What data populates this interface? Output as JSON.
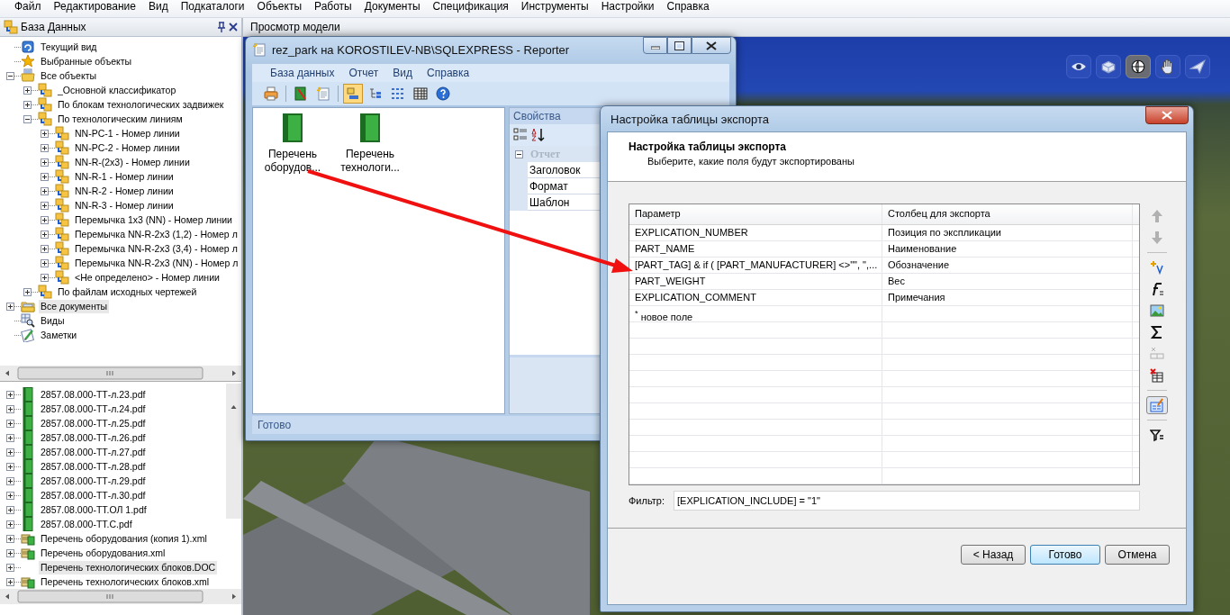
{
  "menu_bar": [
    "Файл",
    "Редактирование",
    "Вид",
    "Подкаталоги",
    "Объекты",
    "Работы",
    "Документы",
    "Спецификация",
    "Инструменты",
    "Настройки",
    "Справка"
  ],
  "database_panel": {
    "title": "База Данных",
    "tree": [
      {
        "label": "Текущий вид",
        "kind": "view",
        "selected": false
      },
      {
        "label": "Выбранные объекты",
        "kind": "star",
        "selected": false
      },
      {
        "label": "Все объекты",
        "kind": "objects",
        "selected": false,
        "expanded": true,
        "children": [
          {
            "label": "_Основной классификатор",
            "kind": "group",
            "selected": false,
            "expanded": false
          },
          {
            "label": "По блокам технологических задвижек",
            "kind": "group",
            "selected": false,
            "expanded": false
          },
          {
            "label": "По технологическим линиям",
            "kind": "group",
            "selected": false,
            "expanded": true,
            "children": [
              {
                "label": "NN-PC-1 - Номер линии",
                "kind": "group",
                "selected": false,
                "expanded": false
              },
              {
                "label": "NN-PC-2 - Номер линии",
                "kind": "group",
                "selected": false,
                "expanded": false
              },
              {
                "label": "NN-R-(2x3) - Номер линии",
                "kind": "group",
                "selected": false,
                "expanded": false
              },
              {
                "label": "NN-R-1 - Номер линии",
                "kind": "group",
                "selected": false,
                "expanded": false
              },
              {
                "label": "NN-R-2 - Номер линии",
                "kind": "group",
                "selected": false,
                "expanded": false
              },
              {
                "label": "NN-R-3 - Номер линии",
                "kind": "group",
                "selected": false,
                "expanded": false
              },
              {
                "label": "Перемычка 1x3 (NN) - Номер линии",
                "kind": "group",
                "selected": false,
                "expanded": false
              },
              {
                "label": "Перемычка NN-R-2x3 (1,2) - Номер л",
                "kind": "group",
                "selected": false,
                "expanded": false
              },
              {
                "label": "Перемычка NN-R-2x3 (3,4) - Номер л",
                "kind": "group",
                "selected": false,
                "expanded": false
              },
              {
                "label": "Перемычка NN-R-2x3 (NN) - Номер л",
                "kind": "group",
                "selected": false,
                "expanded": false
              },
              {
                "label": "<Не определено> - Номер линии",
                "kind": "group",
                "selected": false,
                "expanded": false
              }
            ]
          },
          {
            "label": "По файлам исходных чертежей",
            "kind": "group",
            "selected": false,
            "expanded": false
          }
        ]
      },
      {
        "label": "Все документы",
        "kind": "documents",
        "selected": true,
        "expanded": false
      },
      {
        "label": "Виды",
        "kind": "views",
        "selected": false
      },
      {
        "label": "Заметки",
        "kind": "notes",
        "selected": false
      }
    ],
    "files": [
      {
        "label": "2857.08.000-ТТ-л.23.pdf",
        "kind": "pdf",
        "selected": false,
        "expanded": false
      },
      {
        "label": "2857.08.000-ТТ-л.24.pdf",
        "kind": "pdf",
        "selected": false,
        "expanded": false
      },
      {
        "label": "2857.08.000-ТТ-л.25.pdf",
        "kind": "pdf",
        "selected": false,
        "expanded": false
      },
      {
        "label": "2857.08.000-ТТ-л.26.pdf",
        "kind": "pdf",
        "selected": false,
        "expanded": false
      },
      {
        "label": "2857.08.000-ТТ-л.27.pdf",
        "kind": "pdf",
        "selected": false,
        "expanded": false
      },
      {
        "label": "2857.08.000-ТТ-л.28.pdf",
        "kind": "pdf",
        "selected": false,
        "expanded": false
      },
      {
        "label": "2857.08.000-ТТ-л.29.pdf",
        "kind": "pdf",
        "selected": false,
        "expanded": false
      },
      {
        "label": "2857.08.000-ТТ-л.30.pdf",
        "kind": "pdf",
        "selected": false,
        "expanded": false
      },
      {
        "label": "2857.08.000-ТТ.ОЛ 1.pdf",
        "kind": "pdf",
        "selected": false,
        "expanded": false
      },
      {
        "label": "2857.08.000-ТТ.С.pdf",
        "kind": "pdf",
        "selected": false,
        "expanded": false
      },
      {
        "label": "Перечень оборудования (копия 1).xml",
        "kind": "xml",
        "selected": false,
        "expanded": false
      },
      {
        "label": "Перечень оборудования.xml",
        "kind": "xml",
        "selected": false,
        "expanded": false
      },
      {
        "label": "Перечень технологических блоков.DOC",
        "kind": "doc",
        "selected": true,
        "expanded": false
      },
      {
        "label": "Перечень технологических блоков.xml",
        "kind": "xml",
        "selected": false,
        "expanded": false
      }
    ]
  },
  "model_view": {
    "title": "Просмотр модели",
    "tools": [
      {
        "kind": "eye",
        "selected": false
      },
      {
        "kind": "box",
        "selected": false
      },
      {
        "kind": "globe",
        "selected": true
      },
      {
        "kind": "hand",
        "selected": false
      },
      {
        "kind": "plane",
        "selected": false
      }
    ]
  },
  "reporter": {
    "title": "rez_park на KOROSTILEV-NB\\SQLEXPRESS - Reporter",
    "menu": [
      "База данных",
      "Отчет",
      "Вид",
      "Справка"
    ],
    "toolbar": [
      {
        "kind": "print",
        "selected": false
      },
      {
        "kind": "book",
        "selected": false
      },
      {
        "kind": "document",
        "selected": false
      },
      {
        "kind": "large-icons",
        "selected": true
      },
      {
        "kind": "tree-list",
        "selected": false
      },
      {
        "kind": "list",
        "selected": false
      },
      {
        "kind": "grid",
        "selected": false
      },
      {
        "kind": "help",
        "selected": false
      }
    ],
    "reports": [
      {
        "label": "Перечень оборудов..."
      },
      {
        "label": "Перечень технологи..."
      }
    ],
    "properties": {
      "title": "Свойства",
      "category": {
        "label": "Отчет",
        "expanded": true
      },
      "rows": [
        "Заголовок",
        "Формат",
        "Шаблон"
      ]
    },
    "status": "Готово"
  },
  "dialog": {
    "title": "Настройка таблицы экспорта",
    "heading": "Настройка таблицы экспорта",
    "subheading": "Выберите, какие поля будут экспортированы",
    "columns": [
      "Параметр",
      "Столбец для экспорта"
    ],
    "rows": [
      {
        "parameter": "EXPLICATION_NUMBER",
        "column": "Позиция по экспликации"
      },
      {
        "parameter": "PART_NAME",
        "column": "Наименование"
      },
      {
        "parameter": "[PART_TAG] & if  ( [PART_MANUFACTURER] <>\"\", \",...",
        "column": "Обозначение"
      },
      {
        "parameter": "PART_WEIGHT",
        "column": "Вес"
      },
      {
        "parameter": "EXPLICATION_COMMENT",
        "column": "Примечания"
      }
    ],
    "new_row": "$^{*}$ новое поле",
    "tools": [
      {
        "kind": "up",
        "disabled": true,
        "selected": false
      },
      {
        "kind": "down",
        "disabled": true,
        "selected": false
      },
      {
        "kind": "add-column",
        "disabled": false,
        "selected": false
      },
      {
        "kind": "function",
        "disabled": false,
        "selected": false
      },
      {
        "kind": "picture",
        "disabled": false,
        "selected": false
      },
      {
        "kind": "sigma",
        "disabled": false,
        "selected": false
      },
      {
        "kind": "remove-column",
        "disabled": true,
        "selected": false
      },
      {
        "kind": "delete-table",
        "disabled": false,
        "selected": false
      },
      {
        "kind": "edit-table",
        "disabled": false,
        "selected": true
      },
      {
        "kind": "filter",
        "disabled": false,
        "selected": false
      }
    ],
    "filter": {
      "label": "Фильтр:",
      "value": "[EXPLICATION_INCLUDE] = \"1\""
    },
    "buttons": [
      {
        "label": "< Назад",
        "default": false
      },
      {
        "label": "Готово",
        "default": true
      },
      {
        "label": "Отмена",
        "default": false
      }
    ]
  }
}
